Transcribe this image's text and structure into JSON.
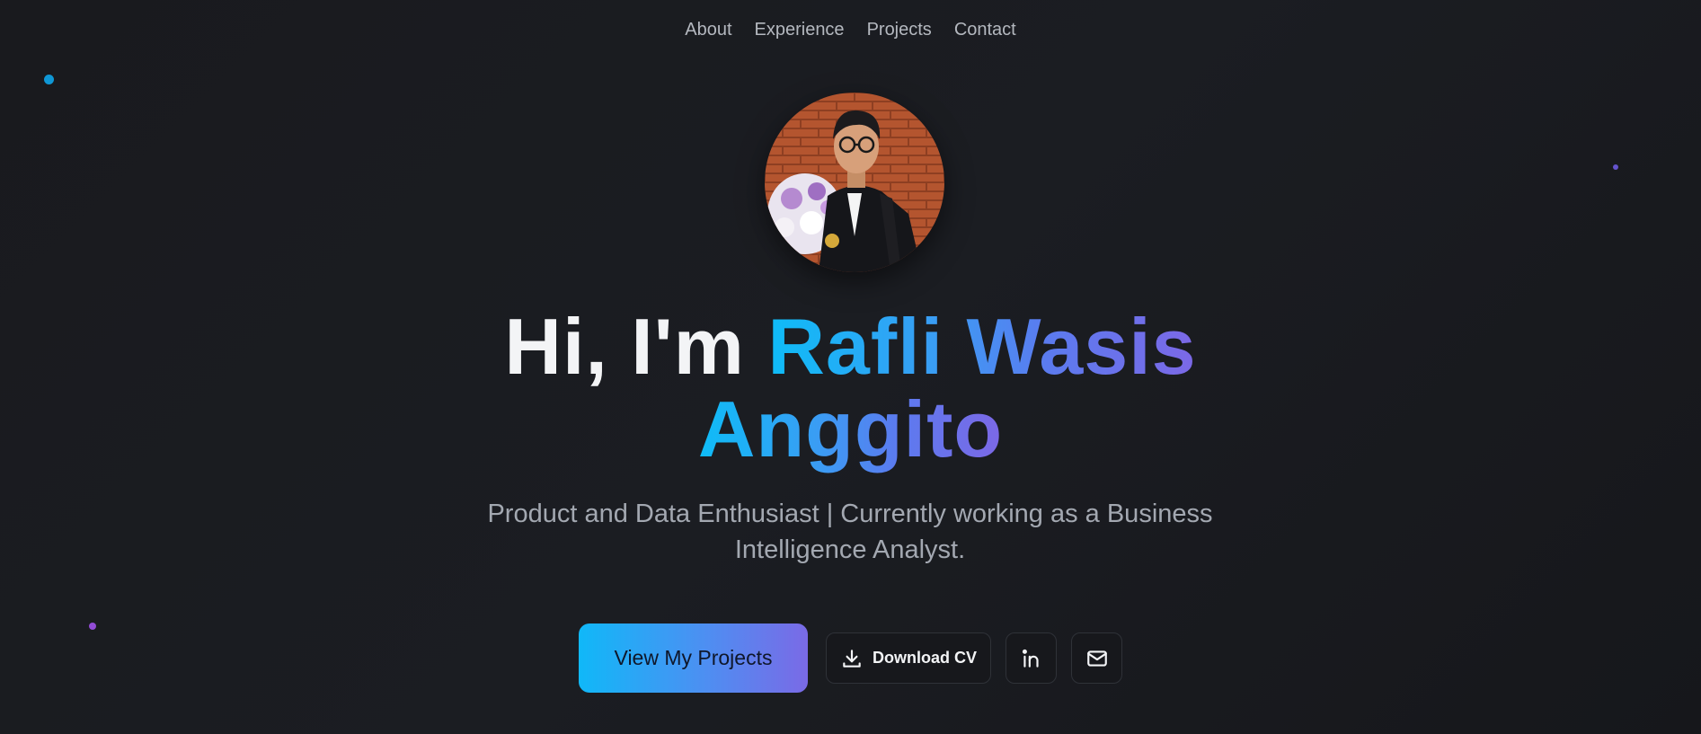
{
  "nav": {
    "items": [
      "About",
      "Experience",
      "Projects",
      "Contact"
    ]
  },
  "hero": {
    "greeting": "Hi, I'm ",
    "name_line1": "Rafli Wasis",
    "name_line2": "Anggito",
    "subtitle_line1": "Product and Data Enthusiast | Currently working as a Business",
    "subtitle_line2": "Intelligence Analyst."
  },
  "actions": {
    "primary_label": "View My Projects",
    "cv_label": "Download CV",
    "icons": [
      "download-icon",
      "linkedin-icon",
      "mail-icon"
    ]
  },
  "colors": {
    "accent_cyan": "#0ebcf7",
    "accent_purple": "#7c68e6",
    "background": "#1b1d22"
  }
}
